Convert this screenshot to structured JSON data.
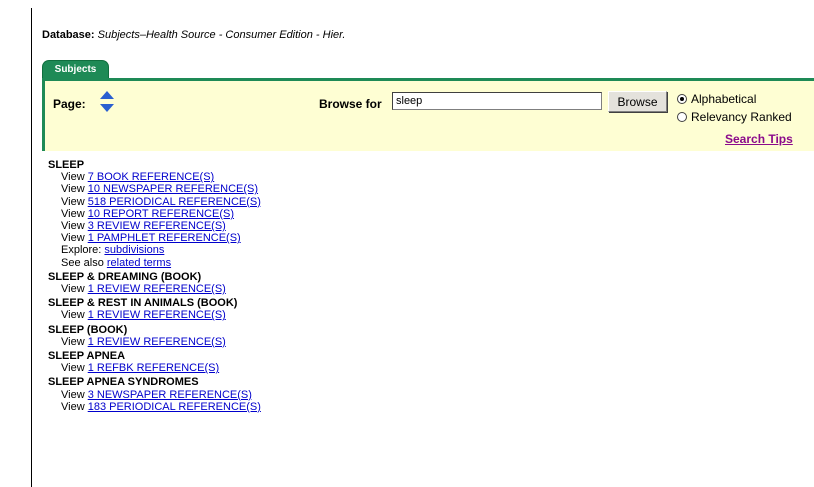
{
  "database": {
    "label": "Database:",
    "name": "Subjects–Health Source - Consumer Edition - Hier."
  },
  "tab": {
    "label": "Subjects"
  },
  "toolbar": {
    "page_label": "Page:",
    "page_arrows_icon": "up-down-arrows-icon",
    "browse_label": "Browse for",
    "browse_value": "sleep",
    "browse_button": "Browse",
    "radio_options": [
      {
        "label": "Alphabetical",
        "checked": true
      },
      {
        "label": "Relevancy Ranked",
        "checked": false
      }
    ],
    "search_tips": "Search Tips"
  },
  "results": [
    {
      "subject": "SLEEP",
      "lines": [
        {
          "prefix": "View ",
          "link": "7 BOOK REFERENCE(S)"
        },
        {
          "prefix": "View ",
          "link": "10 NEWSPAPER REFERENCE(S)"
        },
        {
          "prefix": "View ",
          "link": "518 PERIODICAL REFERENCE(S)"
        },
        {
          "prefix": "View ",
          "link": "10 REPORT REFERENCE(S)"
        },
        {
          "prefix": "View ",
          "link": "3 REVIEW REFERENCE(S)"
        },
        {
          "prefix": "View ",
          "link": "1 PAMPHLET REFERENCE(S)"
        },
        {
          "prefix": "Explore: ",
          "link": "subdivisions"
        },
        {
          "prefix": "See also ",
          "link": "related terms"
        }
      ]
    },
    {
      "subject": "SLEEP & DREAMING (BOOK)",
      "lines": [
        {
          "prefix": "View ",
          "link": "1 REVIEW REFERENCE(S)"
        }
      ]
    },
    {
      "subject": "SLEEP & REST IN ANIMALS (BOOK)",
      "lines": [
        {
          "prefix": "View ",
          "link": "1 REVIEW REFERENCE(S)"
        }
      ]
    },
    {
      "subject": "SLEEP (BOOK)",
      "lines": [
        {
          "prefix": "View ",
          "link": "1 REVIEW REFERENCE(S)"
        }
      ]
    },
    {
      "subject": "SLEEP APNEA",
      "lines": [
        {
          "prefix": "View ",
          "link": "1 REFBK REFERENCE(S)"
        }
      ]
    },
    {
      "subject": "SLEEP APNEA SYNDROMES",
      "lines": [
        {
          "prefix": "View ",
          "link": "3 NEWSPAPER REFERENCE(S)"
        },
        {
          "prefix": "View ",
          "link": "183 PERIODICAL REFERENCE(S)"
        }
      ]
    }
  ],
  "colors": {
    "tab_green": "#1e8a56",
    "panel_yellow": "#fefed3",
    "link_blue": "#0000cc",
    "tips_purple": "#8b0a8b"
  }
}
